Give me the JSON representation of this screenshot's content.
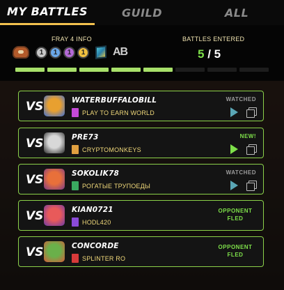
{
  "tabs": [
    {
      "label": "MY BATTLES",
      "active": true
    },
    {
      "label": "GUILD",
      "active": false
    },
    {
      "label": "ALL",
      "active": false
    }
  ],
  "fray": {
    "info_title": "FRAY 4 INFO",
    "coins": [
      "1",
      "1",
      "1",
      "1"
    ],
    "ab_label": "AB",
    "icons": [
      "glove-icon",
      "coin-grey-icon",
      "coin-blue-icon",
      "coin-purple-icon",
      "coin-gold-icon",
      "gem-icon",
      "ab-logo-icon"
    ]
  },
  "battles_entered": {
    "title": "BATTLES ENTERED",
    "done": "5",
    "separator": " / ",
    "total": "5"
  },
  "progress": {
    "filled": 5,
    "segments": 8
  },
  "vs_label": "VS",
  "battles": [
    {
      "opponent": "WATERBUFFALOBILL",
      "guild": "PLAY TO EARN WORLD",
      "status": "WATCHED",
      "status_type": "watched",
      "avatar_colors": [
        "#e8a030",
        "#3b6fd8"
      ],
      "flag_color": "#c64ad8"
    },
    {
      "opponent": "PRE73",
      "guild": "CRYPTOMONKEYS",
      "status": "NEW!",
      "status_type": "new",
      "avatar_colors": [
        "#d8d8d8",
        "#2a2a2a"
      ],
      "flag_color": "#e0a040"
    },
    {
      "opponent": "SOKOLIK78",
      "guild": "РОГАТЫЕ ТРУПОЕДЫ",
      "status": "WATCHED",
      "status_type": "watched",
      "avatar_colors": [
        "#e8703a",
        "#7a3a8a"
      ],
      "flag_color": "#3aa860"
    },
    {
      "opponent": "KIAN0721",
      "guild": "HODL420",
      "status": "OPPONENT FLED",
      "status_type": "fled",
      "avatar_colors": [
        "#e85a5a",
        "#6a3aa8"
      ],
      "flag_color": "#8a4ad8"
    },
    {
      "opponent": "CONCORDE",
      "guild": "SPLINTER RO",
      "status": "OPPONENT FLED",
      "status_type": "fled",
      "avatar_colors": [
        "#6ab04a",
        "#d85a3a"
      ],
      "flag_color": "#d83a3a"
    }
  ],
  "colors": {
    "accent_gold": "#f2c14e",
    "accent_green": "#7ee04a",
    "card_border": "#8cd24a"
  }
}
